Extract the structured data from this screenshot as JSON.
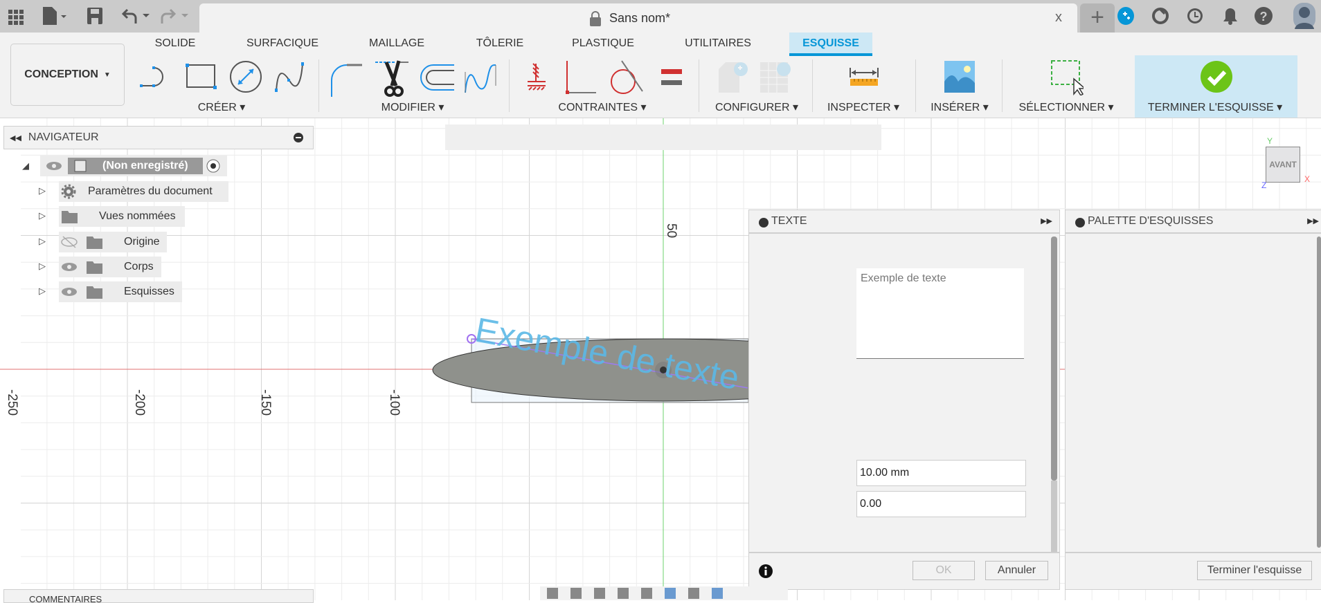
{
  "title_bar": {
    "document_title": "Sans nom*",
    "close_label": "x"
  },
  "workspace": {
    "label": "CONCEPTION"
  },
  "tabs": [
    {
      "label": "SOLIDE"
    },
    {
      "label": "SURFACIQUE"
    },
    {
      "label": "MAILLAGE"
    },
    {
      "label": "TÔLERIE"
    },
    {
      "label": "PLASTIQUE"
    },
    {
      "label": "UTILITAIRES"
    },
    {
      "label": "ESQUISSE",
      "active": true
    }
  ],
  "groups": {
    "creer": "CRÉER",
    "modifier": "MODIFIER",
    "contraintes": "CONTRAINTES",
    "configurer": "CONFIGURER",
    "inspecter": "INSPECTER",
    "inserer": "INSÉRER",
    "selectionner": "SÉLECTIONNER",
    "terminer": "TERMINER L'ESQUISSE"
  },
  "navigator": {
    "title": "NAVIGATEUR",
    "root": "(Non enregistré)",
    "items": [
      {
        "label": "Paramètres du document"
      },
      {
        "label": "Vues nommées"
      },
      {
        "label": "Origine"
      },
      {
        "label": "Corps"
      },
      {
        "label": "Esquisses"
      }
    ]
  },
  "canvas": {
    "x_labels": [
      "-250",
      "-200",
      "-150",
      "-100"
    ],
    "y_label": "50",
    "sketch_text": "Exemple de texte",
    "viewcube": "AVANT",
    "axes": {
      "x": "X",
      "y": "Y",
      "z": "Z"
    }
  },
  "text_panel": {
    "title": "TEXTE",
    "text_value": "Exemple de texte",
    "height_value": "10.00 mm",
    "angle_value": "0.00",
    "ok": "OK",
    "cancel": "Annuler"
  },
  "palette_panel": {
    "title": "PALETTE D'ESQUISSES",
    "finish": "Terminer l'esquisse"
  },
  "comments": {
    "title": "COMMENTAIRES"
  },
  "colors": {
    "accent": "#0696d7",
    "finish_bg": "#cde8f5",
    "sketch_text": "#5bb8e6",
    "profile_fill": "#8f918c"
  }
}
